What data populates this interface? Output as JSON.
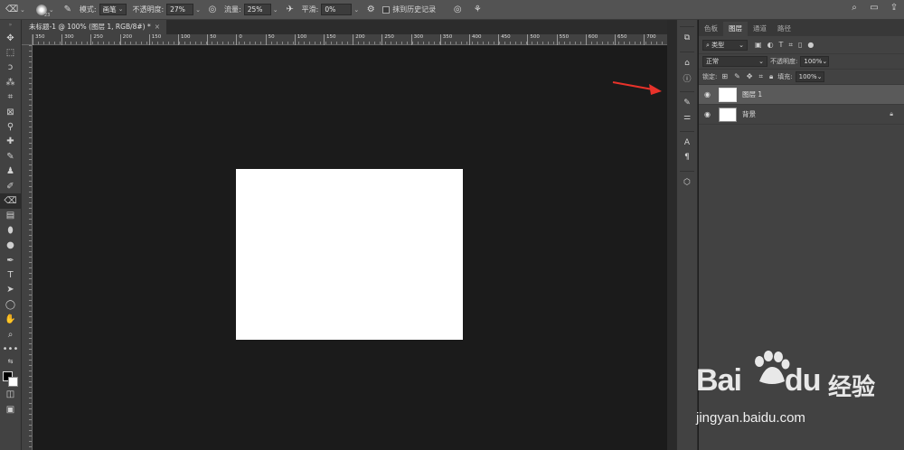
{
  "options_bar": {
    "brush_size": "23",
    "mode_label": "模式:",
    "mode_value": "画笔",
    "opacity_label": "不透明度:",
    "opacity_value": "27%",
    "flow_label": "流量:",
    "flow_value": "25%",
    "smoothing_label": "平滑:",
    "smoothing_value": "0%",
    "erase_history_label": "抹到历史记录"
  },
  "document": {
    "tab_title": "未标题-1 @ 100% (图层 1, RGB/8#) *",
    "tab_close": "×"
  },
  "ruler_labels": [
    "350",
    "300",
    "250",
    "200",
    "150",
    "100",
    "50",
    "0",
    "50",
    "100",
    "150",
    "200",
    "250",
    "300",
    "350",
    "400",
    "450",
    "500",
    "550",
    "600",
    "650",
    "700"
  ],
  "tools": [
    "move-icon",
    "marquee-icon",
    "lasso-icon",
    "magic-wand-icon",
    "crop-icon",
    "frame-icon",
    "eyedropper-icon",
    "healing-icon",
    "brush-icon",
    "stamp-icon",
    "history-brush-icon",
    "eraser-icon",
    "gradient-icon",
    "blur-icon",
    "dodge-icon",
    "pen-icon",
    "type-icon",
    "path-select-icon",
    "shape-icon",
    "hand-icon",
    "zoom-icon",
    "more-icon"
  ],
  "layers_panel": {
    "tabs": [
      "色板",
      "图层",
      "通道",
      "路径"
    ],
    "active_tab": "图层",
    "filter_kind": "类型",
    "blend_mode": "正常",
    "opacity_label": "不透明度:",
    "opacity_value": "100%",
    "lock_label": "锁定:",
    "fill_label": "填充:",
    "fill_value": "100%",
    "layers": [
      {
        "name": "图层 1",
        "selected": true
      },
      {
        "name": "背景",
        "selected": false
      }
    ]
  },
  "watermark": {
    "brand": "Bai",
    "brand2": "du",
    "product": "经验",
    "url": "jingyan.baidu.com"
  },
  "colors": {
    "annotation_arrow": "#e8322a",
    "canvas_bg": "#1b1b1b",
    "panel_bg": "#424242"
  }
}
